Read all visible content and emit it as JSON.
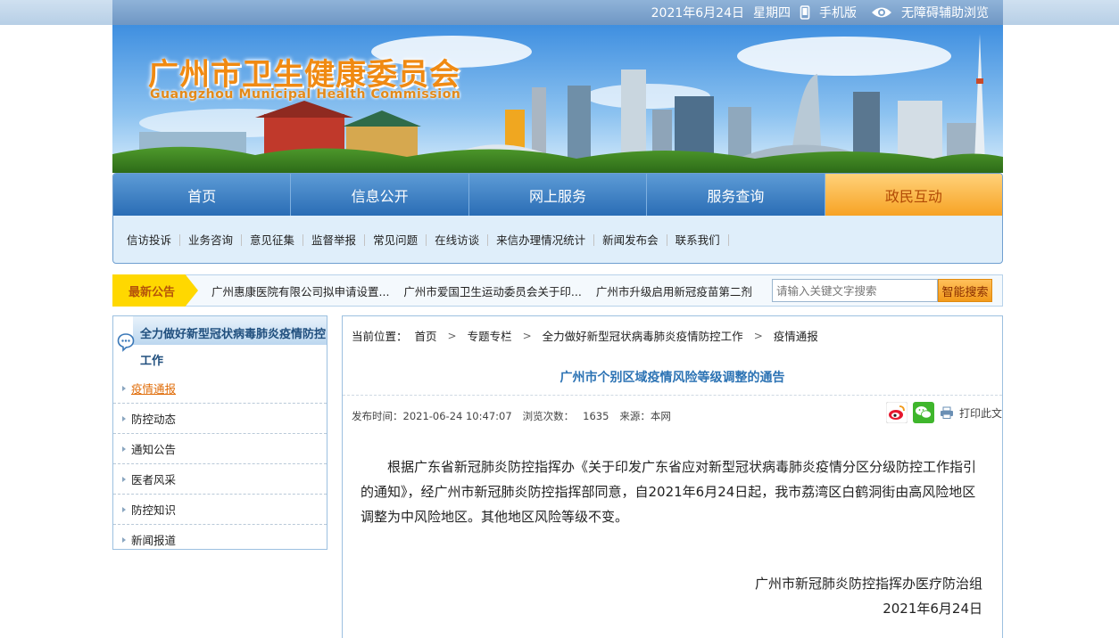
{
  "topbar": {
    "date": "2021年6月24日",
    "weekday": "星期四",
    "mobile_label": "手机版",
    "accessibility_label": "无障碍辅助浏览"
  },
  "banner": {
    "title": "广州市卫生健康委员会",
    "subtitle": "Guangzhou Municipal Health Commission"
  },
  "nav": {
    "main": [
      "首页",
      "信息公开",
      "网上服务",
      "服务查询",
      "政民互动"
    ],
    "active": "政民互动",
    "sub": [
      "信访投诉",
      "业务咨询",
      "意见征集",
      "监督举报",
      "常见问题",
      "在线访谈",
      "来信办理情况统计",
      "新闻发布会",
      "联系我们"
    ]
  },
  "notice": {
    "label": "最新公告",
    "items": [
      "广州惠康医院有限公司拟申请设置...",
      "广州市爱国卫生运动委员会关于印...",
      "广州市升级启用新冠疫苗第二剂"
    ]
  },
  "search": {
    "placeholder": "请输入关键文字搜索",
    "button": "智能搜索"
  },
  "sidebar": {
    "title": "全力做好新型冠状病毒肺炎疫情防控工作",
    "items": [
      "疫情通报",
      "防控动态",
      "通知公告",
      "医者风采",
      "防控知识",
      "新闻报道"
    ],
    "active": "疫情通报"
  },
  "breadcrumb": {
    "label": "当前位置：",
    "items": [
      "首页",
      "专题专栏",
      "全力做好新型冠状病毒肺炎疫情防控工作",
      "疫情通报"
    ]
  },
  "article": {
    "title": "广州市个别区域疫情风险等级调整的通告",
    "publish_label": "发布时间：",
    "publish_time": "2021-06-24 10:47:07",
    "views_label": "浏览次数：",
    "views": "1635",
    "source_label": "来源：",
    "source": "本网",
    "print_label": "打印此文",
    "body": "根据广东省新冠肺炎防控指挥办《关于印发广东省应对新型冠状病毒肺炎疫情分区分级防控工作指引的通知》，经广州市新冠肺炎防控指挥部同意，自2021年6月24日起，我市荔湾区白鹤洞街由高风险地区调整为中风险地区。其他地区风险等级不变。",
    "signature_org": "广州市新冠肺炎防控指挥办医疗防治组",
    "signature_date": "2021年6月24日"
  },
  "icons": {
    "mobile": "mobile-phone-icon",
    "accessibility": "eye-icon",
    "sidebar": "chat-bubble-icon",
    "weibo": "weibo-icon",
    "wechat": "wechat-icon",
    "print": "print-icon"
  },
  "colors": {
    "nav_blue": "#2a6db5",
    "nav_active": "#f7a324",
    "title_blue": "#2c73b4",
    "notice_yellow": "#ffd800",
    "active_link": "#e06d0a"
  }
}
